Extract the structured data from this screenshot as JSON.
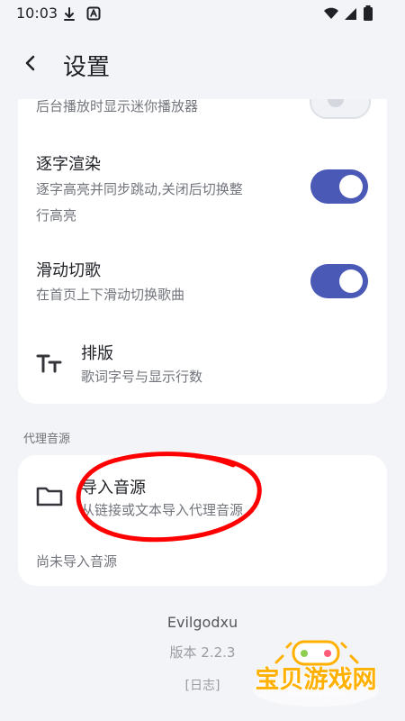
{
  "status_bar": {
    "time": "10:03",
    "icons": [
      "download-icon",
      "a-icon",
      "wifi-icon",
      "signal-icon",
      "battery-icon"
    ]
  },
  "header": {
    "back_icon": "chevron-left-icon",
    "title": "设置"
  },
  "settings": {
    "partial_item_desc": "后台播放时显示迷你播放器",
    "items": [
      {
        "title": "逐字渲染",
        "desc": "逐字高亮并同步跳动,关闭后切换整\n行高亮",
        "toggle": true
      },
      {
        "title": "滑动切歌",
        "desc": "在首页上下滑动切换歌曲",
        "toggle": true
      },
      {
        "icon": "typography-icon",
        "title": "排版",
        "desc": "歌词字号与显示行数"
      }
    ]
  },
  "proxy": {
    "section_title": "代理音源",
    "import_icon": "folder-icon",
    "import_title": "导入音源",
    "import_desc": "从链接或文本导入代理音源",
    "status": "尚未导入音源"
  },
  "footer": {
    "name": "Evilgodxu",
    "version": "版本 2.2.3",
    "log": "[日志]"
  },
  "watermark": {
    "name": "宝贝游戏网",
    "domain": "baobeiy.com"
  },
  "colors": {
    "background": "#f3f4f8",
    "card": "#ffffff",
    "accent": "#4a58b6",
    "annotation": "#ff0000",
    "watermark": "#ffb000"
  }
}
